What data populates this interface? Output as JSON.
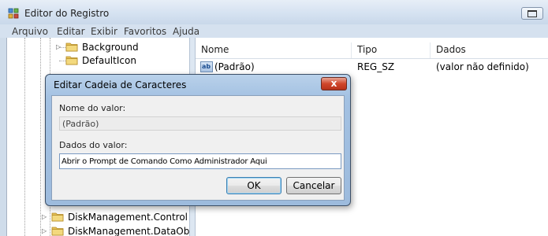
{
  "window": {
    "title": "Editor do Registro"
  },
  "menu": [
    "Arquivo",
    "Editar",
    "Exibir",
    "Favoritos",
    "Ajuda"
  ],
  "tree": {
    "items": [
      {
        "label": "Background",
        "expandable": true
      },
      {
        "label": "DefaultIcon",
        "expandable": false
      },
      {
        "label": "DiskManagement.Control",
        "expandable": true
      },
      {
        "label": "DiskManagement.DataObj",
        "expandable": true
      }
    ]
  },
  "list": {
    "columns": [
      "Nome",
      "Tipo",
      "Dados"
    ],
    "rows": [
      {
        "icon": "string-value-icon",
        "name": "(Padrão)",
        "type": "REG_SZ",
        "data": "(valor não definido)"
      }
    ]
  },
  "dialog": {
    "title": "Editar Cadeia de Caracteres",
    "close_glyph": "x",
    "value_name_label": "Nome do valor:",
    "value_name": "(Padrão)",
    "value_data_label": "Dados do valor:",
    "value_data": "Abrir o Prompt de Comando Como Administrador Aqui",
    "ok_label": "OK",
    "cancel_label": "Cancelar"
  },
  "colors": {
    "title_bar": "#d5e2f1",
    "dialog_frame": "#a3c1e2",
    "close_button": "#d0462a",
    "folder": "#e8c35a"
  }
}
